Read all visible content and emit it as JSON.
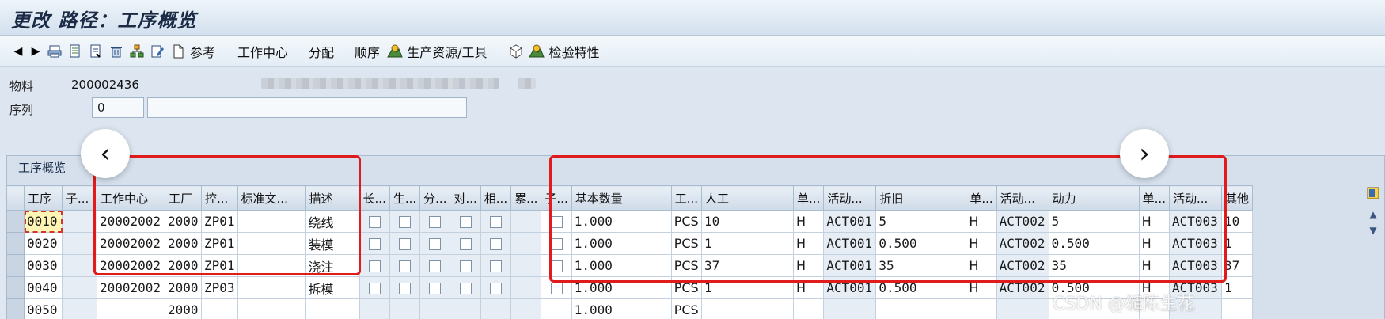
{
  "window": {
    "title": "更改 路径：工序概览"
  },
  "toolbar": {
    "prev_icon": "back-triangle-icon",
    "next_icon": "forward-triangle-icon",
    "ref_label": "参考",
    "work_center": "工作中心",
    "assign": "分配",
    "sequence": "顺序",
    "prt": "生产资源/工具",
    "inspection": "检验特性"
  },
  "header": {
    "material_label": "物料",
    "material_value": "200002436",
    "sequence_label": "序列",
    "sequence_value": "0"
  },
  "overview": {
    "title": "工序概览",
    "columns": {
      "op": "工序",
      "sub": "子...",
      "wc": "工作中心",
      "plant": "工厂",
      "ctrl": "控...",
      "std_text": "标准文...",
      "desc": "描述",
      "long": "长...",
      "prod": "生...",
      "split": "分...",
      "obj": "对...",
      "rel": "相...",
      "cum": "累...",
      "sub2": "子...",
      "base_qty": "基本数量",
      "unit": "工...",
      "labor": "人工",
      "labor_unit": "单...",
      "act1": "活动...",
      "depr": "折旧",
      "depr_unit": "单...",
      "act2": "活动...",
      "power": "动力",
      "power_unit": "单...",
      "act3": "活动...",
      "other": "其他"
    },
    "rows": [
      {
        "op": "0010",
        "wc": "20002002",
        "plant": "2000",
        "ctrl": "ZP01",
        "desc": "绕线",
        "qty": "1.000",
        "unit": "PCS",
        "labor": "10",
        "lu": "H",
        "a1": "ACT001",
        "depr": "5",
        "du": "H",
        "a2": "ACT002",
        "power": "5",
        "pu": "H",
        "a3": "ACT003",
        "other": "10"
      },
      {
        "op": "0020",
        "wc": "20002002",
        "plant": "2000",
        "ctrl": "ZP01",
        "desc": "装模",
        "qty": "1.000",
        "unit": "PCS",
        "labor": "1",
        "lu": "H",
        "a1": "ACT001",
        "depr": "0.500",
        "du": "H",
        "a2": "ACT002",
        "power": "0.500",
        "pu": "H",
        "a3": "ACT003",
        "other": "1"
      },
      {
        "op": "0030",
        "wc": "20002002",
        "plant": "2000",
        "ctrl": "ZP01",
        "desc": "浇注",
        "qty": "1.000",
        "unit": "PCS",
        "labor": "37",
        "lu": "H",
        "a1": "ACT001",
        "depr": "35",
        "du": "H",
        "a2": "ACT002",
        "power": "35",
        "pu": "H",
        "a3": "ACT003",
        "other": "37"
      },
      {
        "op": "0040",
        "wc": "20002002",
        "plant": "2000",
        "ctrl": "ZP03",
        "desc": "拆模",
        "qty": "1.000",
        "unit": "PCS",
        "labor": "1",
        "lu": "H",
        "a1": "ACT001",
        "depr": "0.500",
        "du": "H",
        "a2": "ACT002",
        "power": "0.500",
        "pu": "H",
        "a3": "ACT003",
        "other": "1"
      },
      {
        "op": "0050",
        "wc": "",
        "plant": "2000",
        "ctrl": "",
        "desc": "",
        "qty": "1.000",
        "unit": "PCS",
        "labor": "",
        "lu": "",
        "a1": "",
        "depr": "",
        "du": "",
        "a2": "",
        "power": "",
        "pu": "",
        "a3": "",
        "other": ""
      }
    ]
  },
  "watermark": "CSDN @缱陈生花"
}
